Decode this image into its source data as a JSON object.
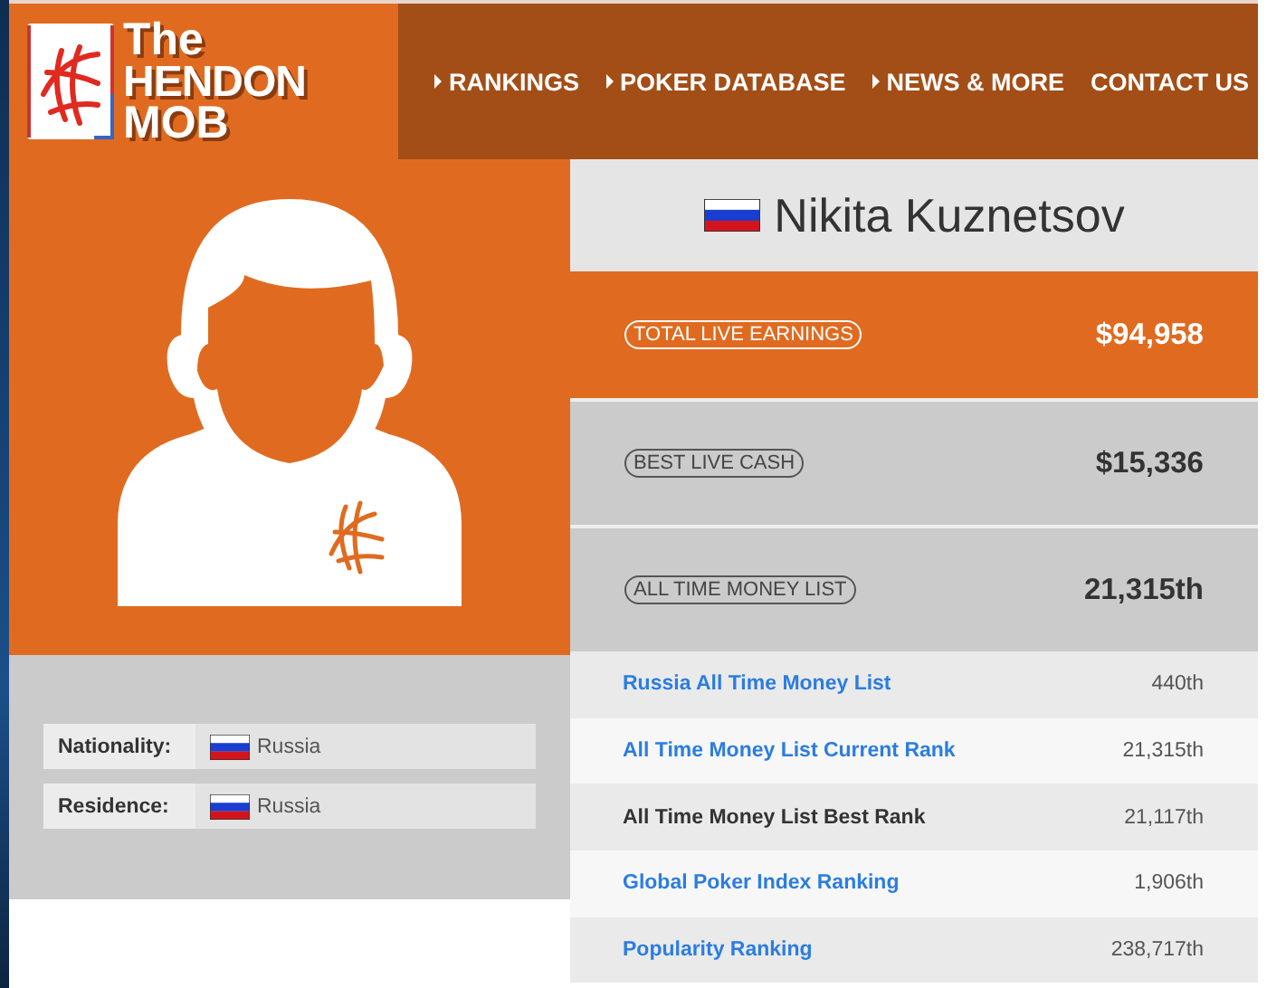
{
  "header": {
    "logo": {
      "line1": "The",
      "line2": "HENDON",
      "line3": "MOB"
    },
    "nav": [
      {
        "label": "RANKINGS",
        "caret": true
      },
      {
        "label": "POKER DATABASE",
        "caret": true
      },
      {
        "label": "NEWS & MORE",
        "caret": true
      },
      {
        "label": "CONTACT US",
        "caret": false
      }
    ]
  },
  "player": {
    "name": "Nikita Kuznetsov",
    "details": [
      {
        "label": "Nationality:",
        "value": "Russia"
      },
      {
        "label": "Residence:",
        "value": "Russia"
      }
    ]
  },
  "stats": [
    {
      "label": "TOTAL LIVE EARNINGS",
      "value": "$94,958",
      "highlight": true
    },
    {
      "label": "BEST LIVE CASH",
      "value": "$15,336",
      "highlight": false
    },
    {
      "label": "ALL TIME MONEY LIST",
      "value": "21,315th",
      "highlight": false
    }
  ],
  "rankings": [
    {
      "label": "Russia All Time Money List",
      "value": "440th",
      "kind": "link"
    },
    {
      "label": "All Time Money List Current Rank",
      "value": "21,315th",
      "kind": "link"
    },
    {
      "label": "All Time Money List Best Rank",
      "value": "21,117th",
      "kind": "text"
    },
    {
      "label": "Global Poker Index Ranking",
      "value": "1,906th",
      "kind": "link"
    },
    {
      "label": "Popularity Ranking",
      "value": "238,717th",
      "kind": "link"
    }
  ]
}
